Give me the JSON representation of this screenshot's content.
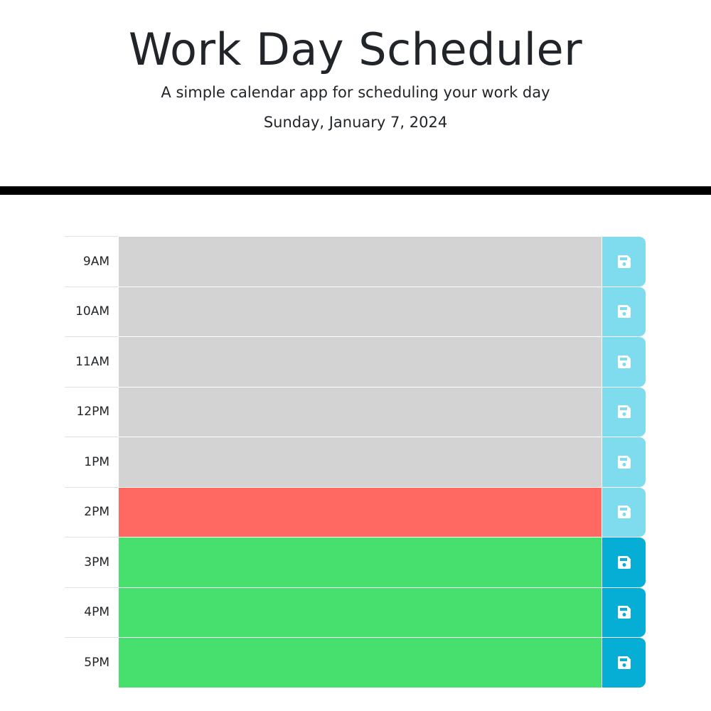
{
  "header": {
    "title": "Work Day Scheduler",
    "subtitle": "A simple calendar app for scheduling your work day",
    "current_day": "Sunday, January 7, 2024"
  },
  "colors": {
    "past": "#d3d3d3",
    "present": "#ff6961",
    "future": "#47e06e",
    "save_button_faded": "#7fdcef",
    "save_button": "#06aed5",
    "divider": "#000000"
  },
  "schedule": {
    "rows": [
      {
        "hour": "9AM",
        "status": "past",
        "text": "",
        "save_icon": "floppy-disk-icon"
      },
      {
        "hour": "10AM",
        "status": "past",
        "text": "",
        "save_icon": "floppy-disk-icon"
      },
      {
        "hour": "11AM",
        "status": "past",
        "text": "",
        "save_icon": "floppy-disk-icon"
      },
      {
        "hour": "12PM",
        "status": "past",
        "text": "",
        "save_icon": "floppy-disk-icon"
      },
      {
        "hour": "1PM",
        "status": "past",
        "text": "",
        "save_icon": "floppy-disk-icon"
      },
      {
        "hour": "2PM",
        "status": "present",
        "text": "",
        "save_icon": "floppy-disk-icon"
      },
      {
        "hour": "3PM",
        "status": "future",
        "text": "",
        "save_icon": "floppy-disk-icon"
      },
      {
        "hour": "4PM",
        "status": "future",
        "text": "",
        "save_icon": "floppy-disk-icon"
      },
      {
        "hour": "5PM",
        "status": "future",
        "text": "",
        "save_icon": "floppy-disk-icon"
      }
    ]
  }
}
